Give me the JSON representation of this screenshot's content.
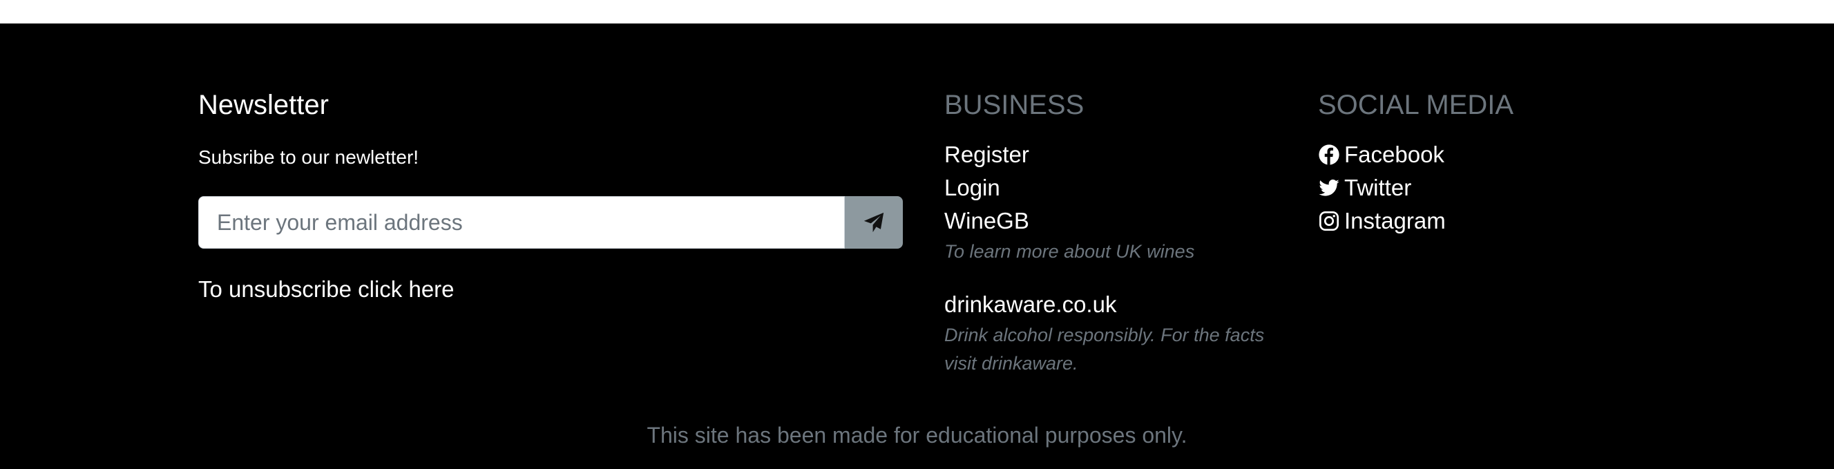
{
  "newsletter": {
    "title": "Newsletter",
    "subtitle": "Subsribe to our newletter!",
    "email_placeholder": "Enter your email address",
    "send_icon": "paper-plane-icon",
    "unsubscribe_label": "To unsubscribe click here"
  },
  "business": {
    "title": "BUSINESS",
    "links": [
      {
        "label": "Register"
      },
      {
        "label": "Login"
      },
      {
        "label": "WineGB",
        "note": "To learn more about UK wines"
      },
      {
        "label": "drinkaware.co.uk",
        "note_lines": [
          "Drink alcohol responsibly. For the facts",
          "visit drinkaware."
        ]
      }
    ]
  },
  "social": {
    "title": "SOCIAL MEDIA",
    "items": [
      {
        "label": "Facebook",
        "icon": "facebook-icon"
      },
      {
        "label": "Twitter",
        "icon": "twitter-icon"
      },
      {
        "label": "Instagram",
        "icon": "instagram-icon"
      }
    ]
  },
  "copyright": "This site has been made for educational purposes only.",
  "colors": {
    "background": "#000000",
    "heading_muted": "#6c757d",
    "send_button": "#8d999f"
  }
}
